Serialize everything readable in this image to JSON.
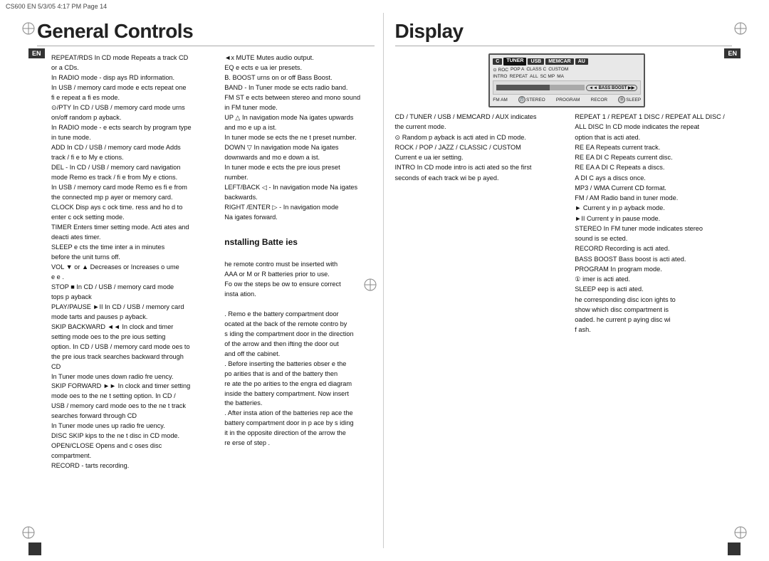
{
  "meta": {
    "top_bar": "CS600 EN  5/3/05  4:17 PM  Page 14"
  },
  "left_section": {
    "title": "General Controls",
    "col1_lines": [
      "REPEAT/RDS  In CD mode   Repeats a track CD",
      "or a  CDs.",
      "In RADIO mode - disp ays RD  information.",
      "In USB / memory card mode    e ects repeat one",
      "fi e  repeat  a   fi es mode.",
      "⊙/PTY  In CD / USB / memory card mode    urns",
      "on/off random p ayback.",
      "In RADIO mode -  e ects search  by program type",
      "in tune mode.",
      "ADD    In CD / USB / memory card mode    Adds",
      "track / fi e to My   e ctions.",
      "DEL -  In CD / USB / memory card navigation",
      "mode    Remo es track / fi e from My  e ctions.",
      "In USB / memory card mode    Remo es fi e from",
      "the connected mp  p ayer or memory card.",
      "CLOCK   Disp ays c ock time.  ress and ho d to",
      "enter c ock setting mode.",
      "TIMER  Enters timer setting mode. Acti ates and",
      "deacti ates timer.",
      "SLEEP   e cts the time inter a  in minutes",
      "before the unit turns off.",
      "VOL ▼ or ▲   Decreases or Increases  o ume",
      "e e .",
      "STOP ■   In CD / USB / memory card mode",
      "tops p ayback",
      "PLAY/PAUSE ►II  In CD / USB / memory card",
      "mode   tarts and pauses p ayback.",
      "SKIP BACKWARD ◄◄   In clock and timer",
      "setting mode    oes to the pre ious setting",
      "option. In CD / USB / memory card mode    oes to",
      "the pre ious track  searches backward through",
      "CD",
      "In Tuner mode    unes down radio fre uency.",
      "SKIP FORWARD ►► In clock and timer setting",
      "mode    oes to the ne t setting option. In CD /",
      "USB / memory card mode    oes to the ne t track",
      "searches forward through CD",
      "In Tuner mode    unes up radio fre uency.",
      "DISC SKIP    kips to the ne t disc in CD mode.",
      "OPEN/CLOSE   Opens and c oses disc",
      "compartment.",
      "RECORD -   tarts recording."
    ],
    "col2_lines": [
      "◄x MUTE   Mutes audio output.",
      "EQ   e ects e  ua ier presets.",
      "B. BOOST    urns on or off Bass Boost.",
      "BAND - In Tuner mode   se ects radio band.",
      "FM ST   e ects between stereo and mono sound",
      "in FM tuner mode.",
      "UP △   In navigation mode   Na igates upwards",
      "and mo e up a  ist.",
      "In tuner mode   se ects the ne t preset number.",
      "DOWN ▽  In navigation mode   Na igates",
      "downwards and mo e down a  ist.",
      "In tuner mode   e ects the pre ious preset",
      "number.",
      "LEFT/BACK ◁ - In navigation mode   Na igates",
      "backwards.",
      "RIGHT /ENTER ▷ - In navigation mode",
      "Na igates forward.",
      "",
      "nstalling Batte ies",
      "",
      " he remote contro  must be inserted with",
      "  AAA or   M   or R    batteries prior to use.",
      "Fo  ow the steps be ow to ensure correct",
      "insta ation.",
      "",
      ". Remo e the battery compartment door",
      "  ocated at the back of the remote contro  by",
      " s iding the compartment door in the direction",
      " of the arrow and then  ifting the door out",
      " and off the cabinet.",
      ". Before inserting the batteries  obser e the",
      " po arities that is  and  of the battery then",
      " re ate the po arities to the engra ed diagram",
      " inside the battery compartment.  Now insert",
      " the batteries.",
      ". After insta ation of the batteries  rep ace the",
      " battery compartment door in p ace by s iding",
      " it  in the opposite direction of the arrow  the",
      " re erse of step  ."
    ]
  },
  "right_section": {
    "title": "Display",
    "lcd": {
      "tabs": [
        "C",
        "TUNER",
        "USB",
        "MEMCAR",
        "AU"
      ],
      "icons_row1": [
        "ROC",
        "POP A",
        "CLASS C",
        "CUSTOM"
      ],
      "icons_row2": [
        "INTRO",
        "REPEAT",
        "ALL",
        "SC MP",
        "MA"
      ],
      "bass_boost": "BASS BOOST",
      "bottom_labels": [
        "FM AM",
        "STEREO",
        "PROGRAM",
        "RECOR",
        "SLEEP"
      ]
    },
    "col1_lines": [
      "CD / TUNER / USB / MEMCARD / AUX    indicates",
      "the current mode.",
      "⊙  Random p ayback is acti ated in CD mode.",
      "ROCK / POP / JAZZ / CLASSIC / CUSTOM",
      "Current e  ua ier setting.",
      "INTRO   In CD mode  intro is acti ated so the first",
      "  seconds of each track wi   be p ayed."
    ],
    "col2_lines": [
      "REPEAT 1 / REPEAT 1 DISC / REPEAT ALL DISC /",
      "ALL DISC  In CD mode  indicates the repeat",
      "option that is acti ated.",
      "RE  EA    Repeats current track.",
      "RE  EA   DI C   Repeats current disc.",
      "RE  EA  A  DI C   Repeats a   discs.",
      "A   DI C    ays a  discs once.",
      "MP3 / WMA    Current CD format.",
      "FM / AM   Radio band in tuner mode.",
      "►  Current y in p ayback mode.",
      "►II  Current y in pause mode.",
      "STEREO  In FM tuner mode  indicates stereo",
      "sound is se ected.",
      "RECORD  Recording is acti ated.",
      "BASS BOOST  Bass boost is acti ated.",
      "PROGRAM   In program mode.",
      "①   imer is acti ated.",
      "SLEEP   eep is acti ated.",
      "   he corresponding disc icon  ights to",
      "show which disc compartment is",
      " oaded.  he current p aying disc wi",
      " f ash."
    ]
  }
}
